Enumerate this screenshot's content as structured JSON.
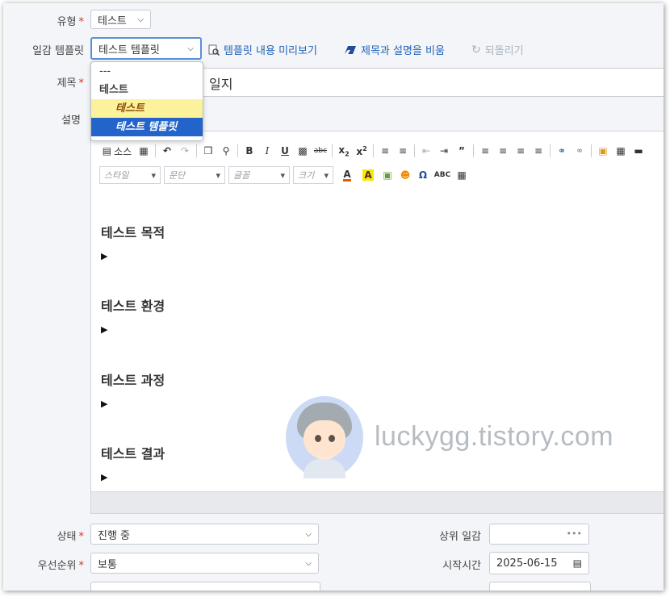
{
  "form": {
    "type_label": "유형",
    "type_value": "테스트",
    "template_label": "일감 템플릿",
    "template_value": "테스트 템플릿",
    "preview_link": "템플릿 내용 미리보기",
    "clear_link": "제목과 설명을 비움",
    "undo_link": "되돌리기",
    "subject_label": "제목",
    "subject_value_visible": "일지",
    "description_label": "설명",
    "status_label": "상태",
    "status_value": "진행 중",
    "priority_label": "우선순위",
    "priority_value": "보통",
    "parent_label": "상위 일감",
    "parent_value": "•••",
    "start_label": "시작시간",
    "start_value": "2025-06-15"
  },
  "dropdown": {
    "items": [
      {
        "label": "---",
        "kind": "plain"
      },
      {
        "label": "테스트",
        "kind": "group"
      },
      {
        "label": "테스트",
        "kind": "highlight"
      },
      {
        "label": "테스트 템플릿",
        "kind": "selected"
      }
    ]
  },
  "toolbar": {
    "source_label": "소스",
    "row1_icons": [
      "source-icon",
      "save-as-template-icon",
      "undo-icon",
      "redo-icon",
      "find-icon",
      "replace-icon",
      "bold-icon",
      "italic-icon",
      "underline-icon",
      "remove-format-icon",
      "strikethrough-icon",
      "subscript-icon",
      "superscript-icon",
      "numbered-list-icon",
      "bulleted-list-icon",
      "outdent-icon",
      "indent-icon",
      "blockquote-icon",
      "align-left-icon",
      "align-center-icon",
      "align-right-icon",
      "justify-icon",
      "link-icon",
      "unlink-icon",
      "image-icon",
      "table-icon",
      "horizontal-line-icon"
    ],
    "style_label": "스타일",
    "format_label": "문단",
    "font_label": "글꼴",
    "size_label": "크기"
  },
  "content": {
    "sections": [
      {
        "heading": "테스트 목적",
        "bullet": "▶"
      },
      {
        "heading": "테스트 환경",
        "bullet": "▶"
      },
      {
        "heading": "테스트 과정",
        "bullet": "▶"
      },
      {
        "heading": "테스트 결과",
        "bullet": "▶"
      }
    ]
  },
  "watermark": "luckygg.tistory.com",
  "colors": {
    "accent": "#2264c9",
    "link": "#1f62b9",
    "required": "#d9342b",
    "highlight": "#fbf29b"
  }
}
